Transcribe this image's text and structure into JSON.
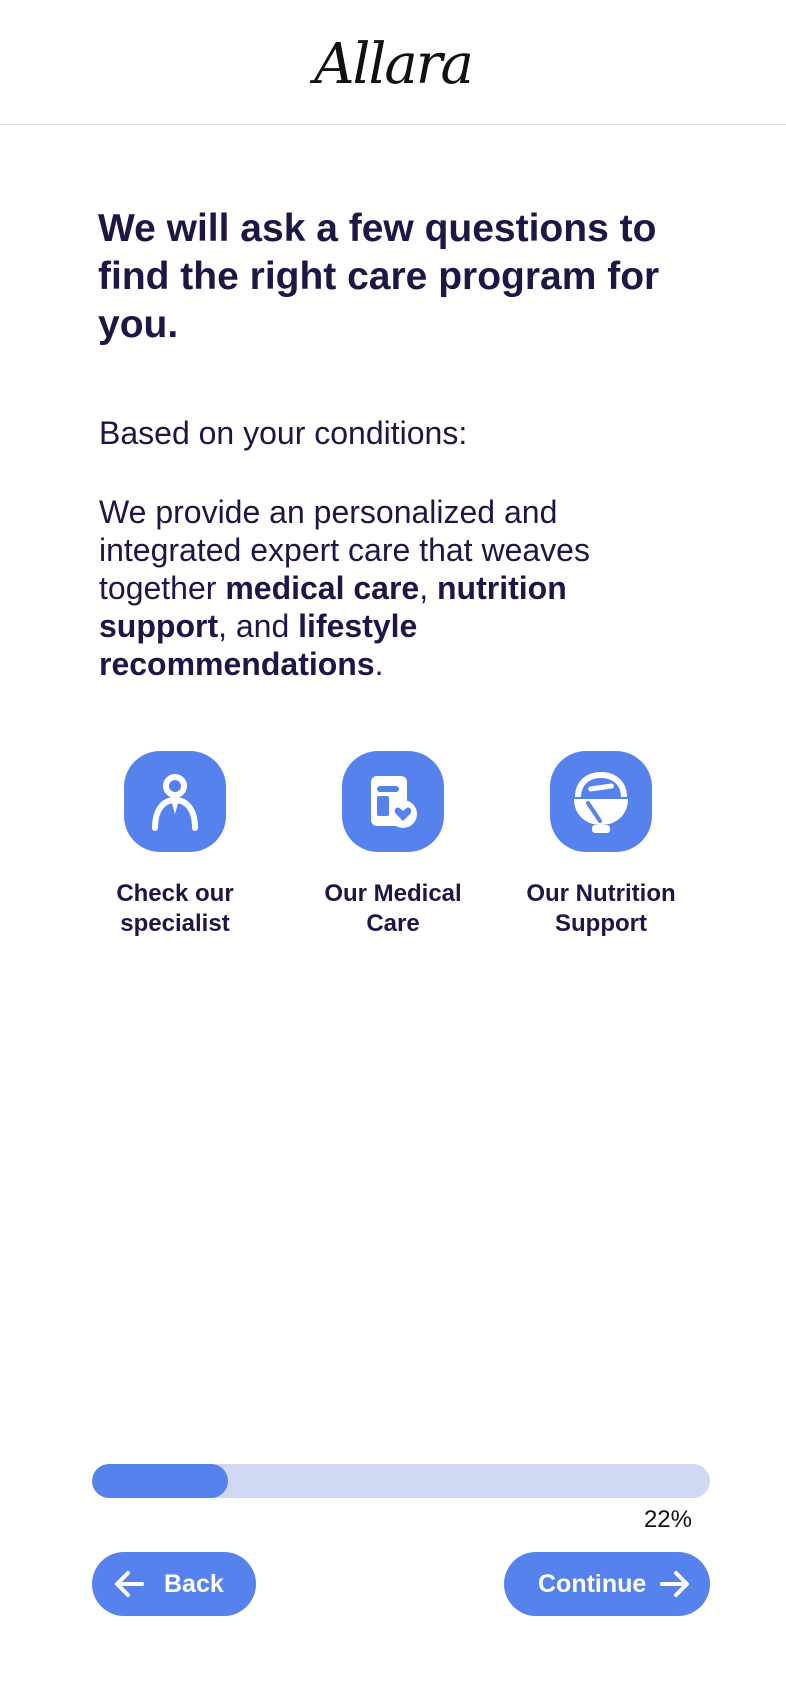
{
  "brand": {
    "logo_text": "Allara"
  },
  "main": {
    "headline": "We will ask a few questions to find the right care program for you.",
    "intro": "Based on your conditions:",
    "description": {
      "part1": "We provide an personalized and integrated expert care that weaves together ",
      "bold1": "medical care",
      "sep1": ", ",
      "bold2": "nutrition support",
      "sep2": ", and ",
      "bold3": "lifestyle recommendations",
      "end": "."
    }
  },
  "features": [
    {
      "icon": "specialist-person-icon",
      "label_line1": "Check our",
      "label_line2": "specialist"
    },
    {
      "icon": "medical-care-icon",
      "label_line1": "Our Medical",
      "label_line2": "Care"
    },
    {
      "icon": "nutrition-bowl-icon",
      "label_line1": "Our Nutrition",
      "label_line2": "Support"
    }
  ],
  "progress": {
    "value_percent": 22,
    "label": "22%"
  },
  "nav": {
    "back_label": "Back",
    "continue_label": "Continue"
  },
  "colors": {
    "accent": "#5682ed",
    "track": "#d0d8f4",
    "text_primary": "#1b1846"
  }
}
